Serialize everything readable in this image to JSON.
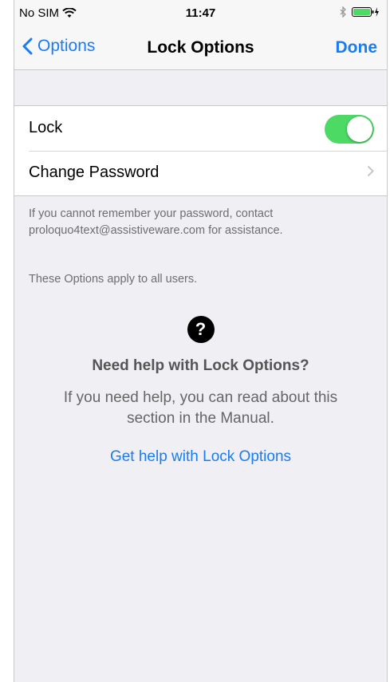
{
  "status": {
    "carrier": "No SIM",
    "time": "11:47"
  },
  "nav": {
    "back_label": "Options",
    "title": "Lock Options",
    "done_label": "Done"
  },
  "settings": {
    "lock_label": "Lock",
    "lock_on": true,
    "change_password_label": "Change Password"
  },
  "footnotes": {
    "line1": "If you cannot remember your password, contact",
    "line2": "proloquo4text@assistiveware.com for assistance.",
    "apply": "These Options apply to all users."
  },
  "help": {
    "icon_glyph": "?",
    "title": "Need help with Lock Options?",
    "body_line1": "If you need help, you can read about this",
    "body_line2": "section in the Manual.",
    "link": "Get help with Lock Options"
  },
  "colors": {
    "accent": "#1a7cf5",
    "toggle_on": "#4cd964",
    "background": "#efeff4"
  },
  "icons": [
    "wifi-icon",
    "bluetooth-icon",
    "battery-icon",
    "chevron-left-icon",
    "chevron-right-icon",
    "help-icon"
  ]
}
